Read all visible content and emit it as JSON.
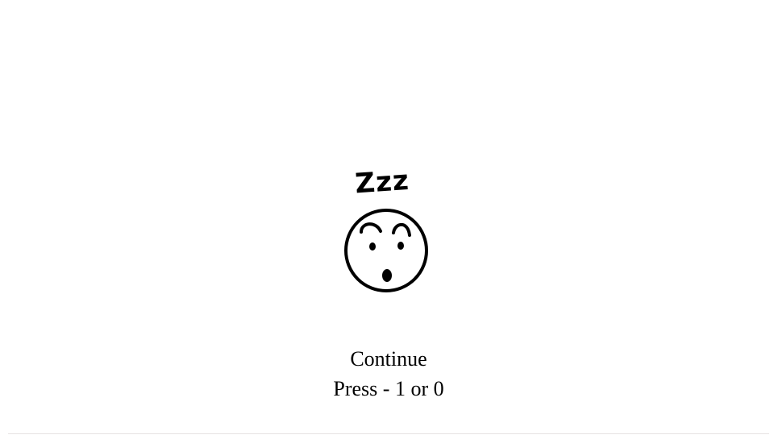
{
  "illustration": {
    "icon": "sleeping-face-icon",
    "caption_glyph": "Zzz"
  },
  "prompt": {
    "title": "Continue",
    "instruction": "Press - 1 or 0"
  }
}
